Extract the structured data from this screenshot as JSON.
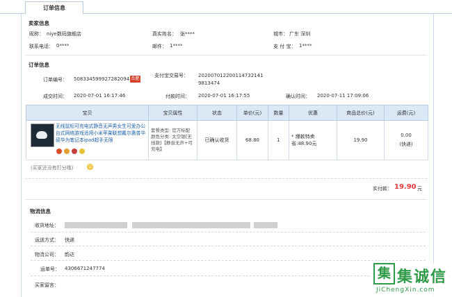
{
  "tab": {
    "label": "订单信息"
  },
  "seller": {
    "title": "卖家信息",
    "nick_label": "昵称：",
    "nick": "niye数码旗舰店",
    "realname_label": "真实姓名：",
    "realname": "张****",
    "city_label": "城市：",
    "city": "广东 深圳",
    "phone_label": "联系电话：",
    "phone": "0****",
    "email_label": "邮件：",
    "email": "1****",
    "alipay_label": "支 付 宝：",
    "alipay": "1****"
  },
  "order": {
    "title": "订单信息",
    "no_label": "订单编号：",
    "no": "508334599927282094",
    "badge": "合肥",
    "trade_label": "支付宝交易号：",
    "trade": "2020070122001147321419813474",
    "created_label": "成交时间：",
    "created": "2020-07-01 16:17:46",
    "paid_label": "付款时间：",
    "paid": "2020-07-01 16:17:55",
    "confirm_label": "确认时间：",
    "confirm": "2020-07-11 17:09:06"
  },
  "goods": {
    "headers": [
      "宝贝",
      "宝贝属性",
      "状态",
      "单价(元)",
      "数量",
      "优惠",
      "商品总价(元)",
      "运费(元)"
    ],
    "title": "无线鼠标可充电式静音无声男女生可爱办公台式网络游戏适用小米苹果联想戴尔惠普华硕华为笔记本ipad超手无限",
    "attrs": "套餐类型: 官方标配 颜色分类: 太空银[无线款]【静音无声+可充电】",
    "status": "已确认收货",
    "price": "68.80",
    "qty": "1",
    "discount": "* 爆款特卖省:48.90元",
    "subtotal": "19.90",
    "shipping": "0.00",
    "shipping_method": "(快递)"
  },
  "note": "(买家还没有打分哦)",
  "total": {
    "label": "实付款：",
    "value": "19.90",
    "unit": "元"
  },
  "logistics": {
    "title": "物流信息",
    "address_label": "收货地址：",
    "method_label": "运送方式：",
    "method": "快递",
    "company_label": "物流公司：",
    "company": "韵达",
    "waybill_label": "运单号：",
    "waybill": "4306671247774",
    "message_label": "买家留言："
  },
  "watermark": {
    "cn": "集诚信",
    "en": "JiChengXin.com",
    "mark": "集"
  },
  "colors": {
    "accent": "#e4393c",
    "link": "#1c5fa8",
    "header_bg": "#dbe9f7",
    "logo": "#2f9a48"
  }
}
